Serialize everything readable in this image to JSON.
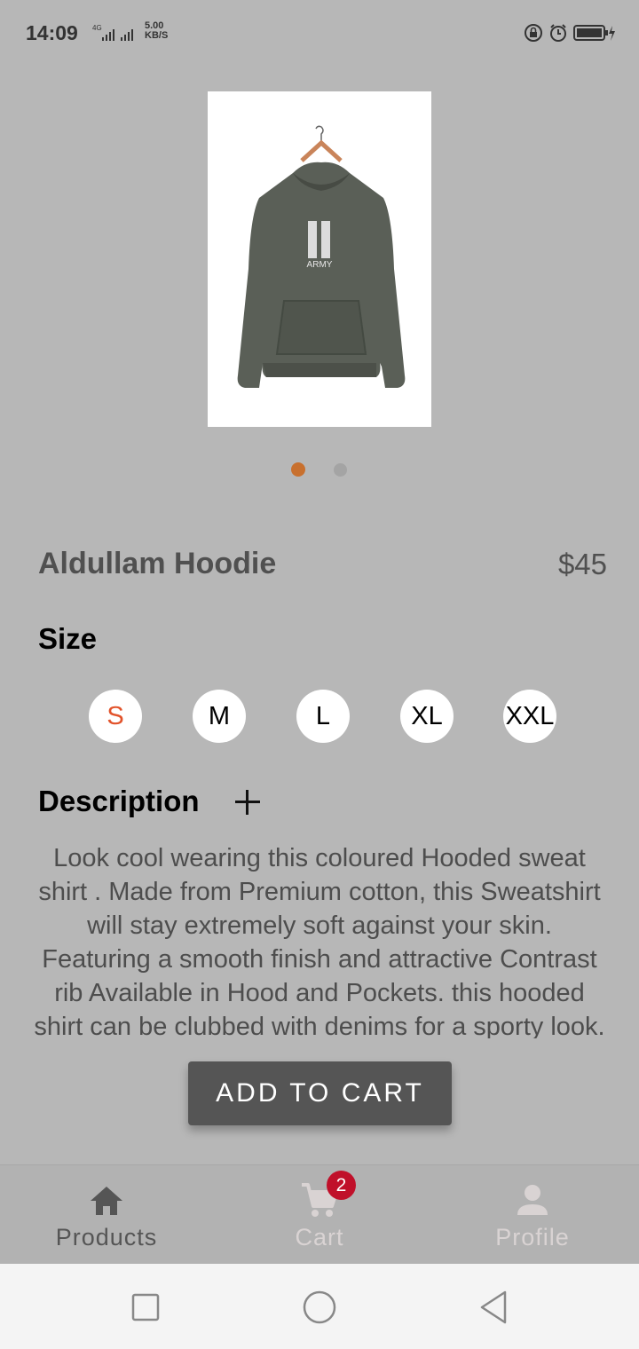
{
  "status_bar": {
    "time": "14:09",
    "network": "4G",
    "speed_value": "5.00",
    "speed_unit": "KB/S"
  },
  "product": {
    "name": "Aldullam Hoodie",
    "price": "$45",
    "image_count": 2,
    "active_image": 1,
    "image_logo_text": "ARMY"
  },
  "size": {
    "heading": "Size",
    "options": [
      "S",
      "M",
      "L",
      "XL",
      "XXL"
    ],
    "selected": "S"
  },
  "description": {
    "heading": "Description",
    "lines": [
      "Look cool wearing this coloured Hooded sweat",
      "shirt . Made from Premium cotton, this Sweatshirt",
      "will stay extremely soft against your skin.",
      "Featuring a smooth finish and attractive Contrast",
      "rib Available in Hood and Pockets. this hooded",
      "shirt can be clubbed with denims for a sporty look."
    ]
  },
  "add_to_cart_label": "ADD TO CART",
  "bottom_nav": {
    "items": [
      {
        "label": "Products",
        "icon": "home-icon",
        "color": "#555555"
      },
      {
        "label": "Cart",
        "icon": "cart-icon",
        "color": "#d9d3d3"
      },
      {
        "label": "Profile",
        "icon": "person-icon",
        "color": "#d9d3d3"
      }
    ],
    "cart_badge": "2"
  },
  "colors": {
    "accent": "#c8702e",
    "selected_size": "#e2532b",
    "badge": "#c0102a",
    "button": "#555555",
    "hoodie": "#5a5f57"
  }
}
